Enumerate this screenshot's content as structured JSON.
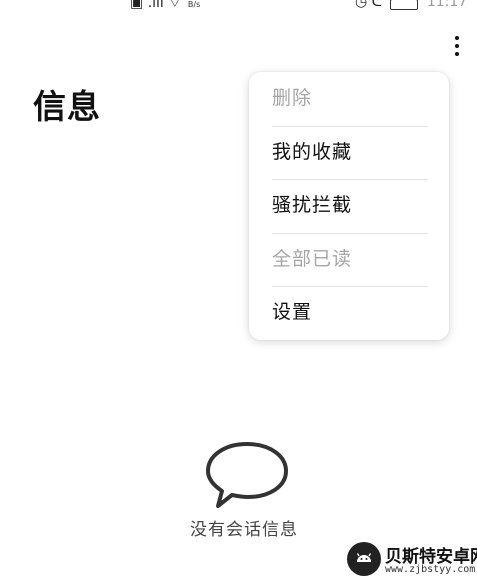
{
  "status_bar": {
    "network_speed_unit": "B/s",
    "time": "11:17"
  },
  "header": {
    "title": "信息",
    "more_icon": "more-vertical-icon"
  },
  "menu": {
    "items": [
      {
        "label": "删除",
        "enabled": false
      },
      {
        "label": "我的收藏",
        "enabled": true
      },
      {
        "label": "骚扰拦截",
        "enabled": true
      },
      {
        "label": "全部已读",
        "enabled": false
      },
      {
        "label": "设置",
        "enabled": true
      }
    ]
  },
  "empty_state": {
    "icon": "chat-bubble-icon",
    "text": "没有会话信息"
  },
  "watermark": {
    "title": "贝斯特安卓网",
    "url": "www.zjbstyy.com"
  },
  "colors": {
    "text_primary": "#111111",
    "text_disabled": "#a6a6a6",
    "divider": "#e4e4e4",
    "background": "#ffffff"
  }
}
